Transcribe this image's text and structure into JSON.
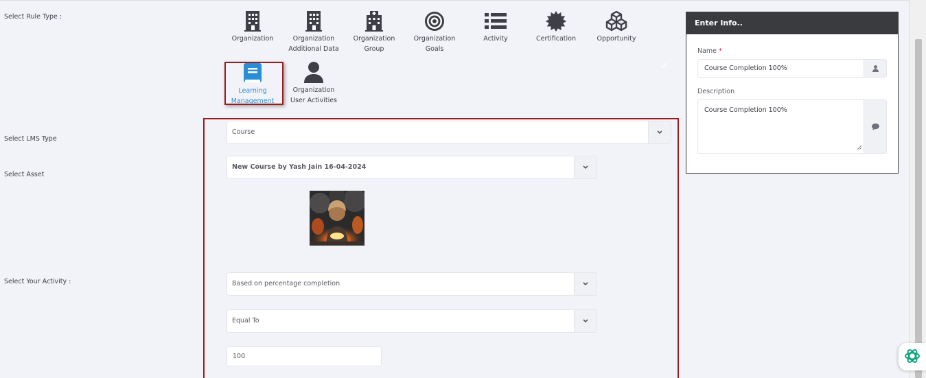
{
  "labels": {
    "rule_type": "Select Rule Type :",
    "lms_type": "Select LMS Type",
    "asset": "Select Asset",
    "activity": "Select Your Activity :"
  },
  "rule_types": [
    {
      "line1": "Organization",
      "line2": "",
      "icon": "building-icon"
    },
    {
      "line1": "Organization",
      "line2": "Additional Data",
      "icon": "building-icon"
    },
    {
      "line1": "Organization",
      "line2": "Group",
      "icon": "hospital-building-icon"
    },
    {
      "line1": "Organization",
      "line2": "Goals",
      "icon": "target-icon"
    },
    {
      "line1": "Activity",
      "line2": "",
      "icon": "list-icon"
    },
    {
      "line1": "Certification",
      "line2": "",
      "icon": "certificate-badge-icon"
    },
    {
      "line1": "Opportunity",
      "line2": "",
      "icon": "cubes-icon"
    },
    {
      "line1": "Learning",
      "line2": "Management",
      "icon": "book-icon",
      "selected": true
    },
    {
      "line1": "Organization",
      "line2": "User Activities",
      "icon": "user-icon"
    }
  ],
  "form": {
    "lms_type": "Course",
    "asset": "New Course by Yash Jain 16-04-2024",
    "activity": "Based on percentage completion",
    "operator": "Equal To",
    "value": "100"
  },
  "panel": {
    "title": "Enter Info..",
    "name_label": "Name",
    "required_mark": "*",
    "name_value": "Course Completion 100%",
    "description_label": "Description",
    "description_value": "Course Completion 100%"
  },
  "colors": {
    "accent": "#2a8ed6",
    "highlight_border": "#9b1c1c",
    "panel_header": "#3a3b3f",
    "assistant_icon": "#10a37f"
  }
}
